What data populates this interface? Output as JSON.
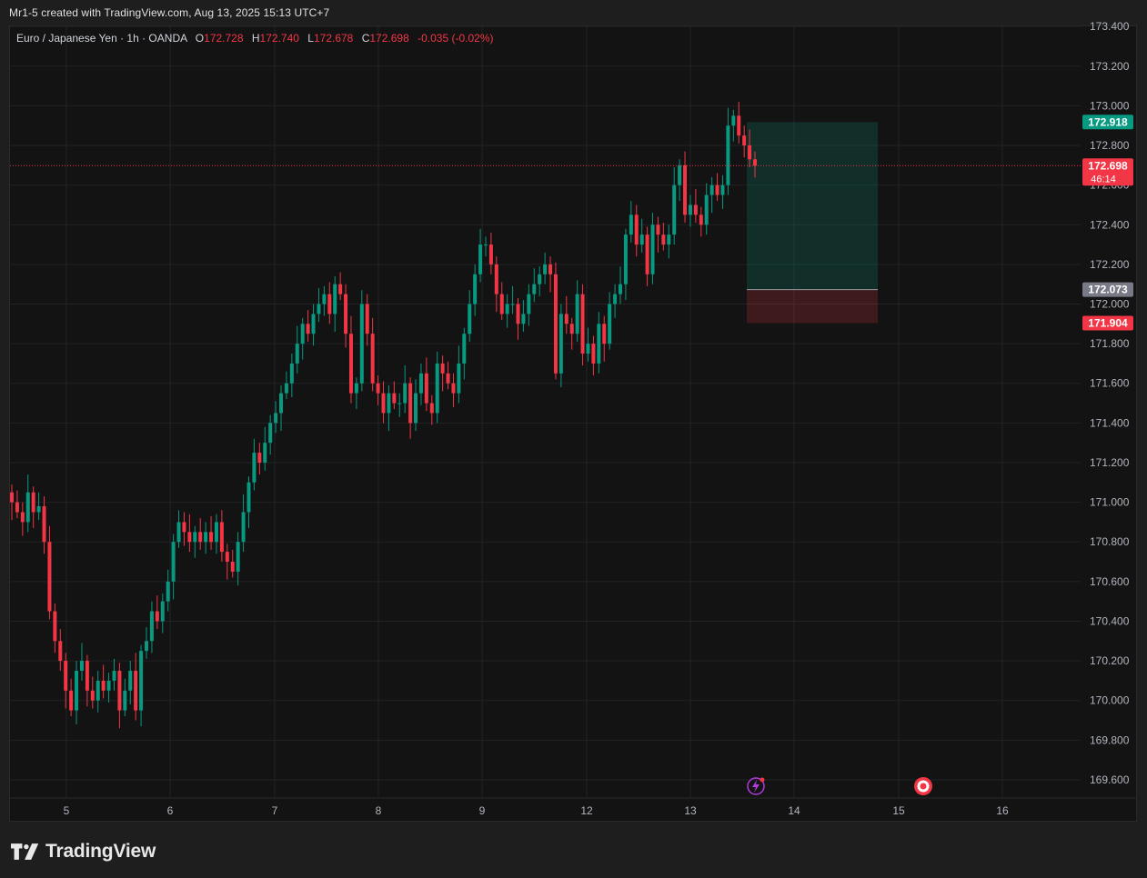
{
  "header": {
    "credit": "Mr1-5 created with TradingView.com, Aug 13, 2025 15:13 UTC+7"
  },
  "legend": {
    "symbol": "Euro / Japanese Yen · 1h · OANDA",
    "open_label": "O",
    "open": "172.728",
    "high_label": "H",
    "high": "172.740",
    "low_label": "L",
    "low": "172.678",
    "close_label": "C",
    "close": "172.698",
    "change": "-0.035 (-0.02%)"
  },
  "price_axis": {
    "ticks": [
      "173.400",
      "173.200",
      "173.000",
      "172.800",
      "172.600",
      "172.400",
      "172.200",
      "172.000",
      "171.800",
      "171.600",
      "171.400",
      "171.200",
      "171.000",
      "170.800",
      "170.600",
      "170.400",
      "170.200",
      "170.000",
      "169.800",
      "169.600"
    ]
  },
  "time_axis": {
    "ticks": [
      "5",
      "6",
      "7",
      "8",
      "9",
      "12",
      "13",
      "14",
      "15",
      "16"
    ]
  },
  "price_tags": {
    "take_profit": {
      "value": "172.918",
      "color": "#089981"
    },
    "last_price": {
      "value": "172.698",
      "countdown": "46:14",
      "color": "#f23645"
    },
    "entry": {
      "value": "172.073",
      "color": "#787b86"
    },
    "stop_loss": {
      "value": "171.904",
      "color": "#f23645"
    }
  },
  "colors": {
    "up": "#089981",
    "down": "#f23645",
    "grid": "#222326",
    "bg": "#131313"
  },
  "icons": {
    "flash": "flash-icon",
    "target": "record-icon"
  },
  "brand": {
    "name": "TradingView"
  },
  "chart_data": {
    "type": "candlestick",
    "timeframe": "1h",
    "ylim": [
      169.55,
      173.43
    ],
    "x_ticks": [
      "5",
      "6",
      "7",
      "8",
      "9",
      "12",
      "13",
      "14",
      "15",
      "16"
    ],
    "position": {
      "type": "short",
      "entry": 172.073,
      "stop": 171.904,
      "target": 172.918
    },
    "last_price": 172.698,
    "closes": [
      171.0,
      170.95,
      170.9,
      171.05,
      170.95,
      170.98,
      170.8,
      170.45,
      170.3,
      170.2,
      170.05,
      169.95,
      170.15,
      170.2,
      170.05,
      170.0,
      170.1,
      170.05,
      170.1,
      170.15,
      169.95,
      170.05,
      170.15,
      169.95,
      170.25,
      170.3,
      170.45,
      170.4,
      170.5,
      170.6,
      170.8,
      170.9,
      170.85,
      170.8,
      170.85,
      170.8,
      170.85,
      170.8,
      170.9,
      170.75,
      170.7,
      170.65,
      170.8,
      170.95,
      171.1,
      171.25,
      171.2,
      171.3,
      171.4,
      171.45,
      171.55,
      171.6,
      171.7,
      171.8,
      171.9,
      171.85,
      171.95,
      172.0,
      172.05,
      171.95,
      172.1,
      172.05,
      171.85,
      171.55,
      171.6,
      172.0,
      171.85,
      171.6,
      171.55,
      171.45,
      171.55,
      171.5,
      171.5,
      171.6,
      171.4,
      171.55,
      171.65,
      171.5,
      171.45,
      171.7,
      171.65,
      171.6,
      171.55,
      171.7,
      171.85,
      172.0,
      172.15,
      172.3,
      172.3,
      172.2,
      172.05,
      171.95,
      172.0,
      172.0,
      171.9,
      171.95,
      172.05,
      172.1,
      172.15,
      172.2,
      172.15,
      171.65,
      171.95,
      171.9,
      171.85,
      172.05,
      171.75,
      171.8,
      171.7,
      171.9,
      171.8,
      172.0,
      172.05,
      172.1,
      172.35,
      172.45,
      172.3,
      172.35,
      172.15,
      172.4,
      172.35,
      172.3,
      172.35,
      172.6,
      172.7,
      172.45,
      172.5,
      172.45,
      172.4,
      172.55,
      172.6,
      172.55,
      172.6,
      172.9,
      172.95,
      172.85,
      172.8,
      172.73,
      172.698
    ]
  }
}
